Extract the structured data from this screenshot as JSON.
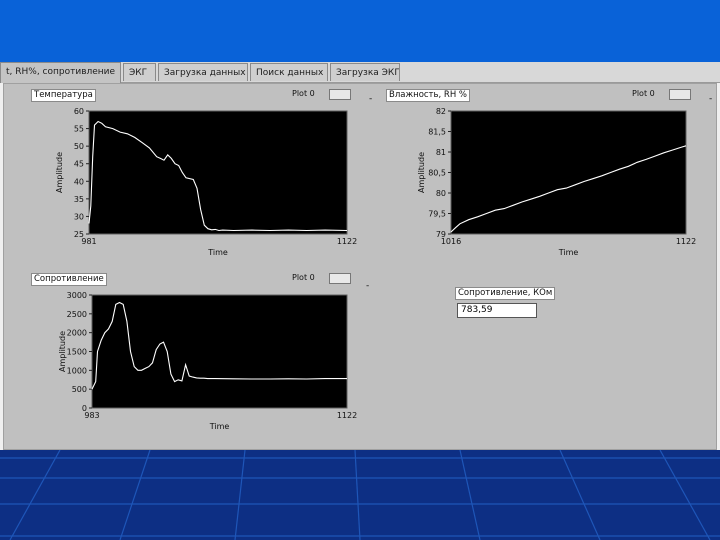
{
  "tabs": [
    {
      "label": "t, RH%, сопротивление"
    },
    {
      "label": "ЭКГ"
    },
    {
      "label": "Загрузка данных"
    },
    {
      "label": "Поиск данных"
    },
    {
      "label": "Загрузка ЭКГ"
    }
  ],
  "dash_marks": [
    "-",
    "-",
    "-"
  ],
  "result": {
    "label": "Сопротивление, КОм",
    "value": "783,59"
  },
  "colors": {
    "plot_bg": "#000000",
    "trace": "#ffffff",
    "panel": "#c0c0c0",
    "slide_blue": "#0962d8"
  },
  "chart_data": [
    {
      "type": "line",
      "title": "Температура",
      "legend": "Plot 0",
      "xlabel": "Time",
      "ylabel": "Amplitude",
      "xlim": [
        981,
        1122
      ],
      "ylim": [
        25,
        60
      ],
      "xticks": [
        "981",
        "1122"
      ],
      "yticks": [
        "60",
        "55",
        "50",
        "45",
        "40",
        "35",
        "30",
        "25"
      ],
      "x": [
        981,
        982,
        983,
        984,
        986,
        988,
        990,
        994,
        998,
        1002,
        1006,
        1010,
        1014,
        1018,
        1020,
        1022,
        1024,
        1026,
        1028,
        1030,
        1032,
        1034,
        1038,
        1040,
        1042,
        1044,
        1046,
        1048,
        1050,
        1052,
        1054,
        1060,
        1070,
        1080,
        1090,
        1100,
        1110,
        1122
      ],
      "y": [
        28,
        33,
        47,
        56,
        57,
        56.5,
        55.5,
        55,
        54,
        53.5,
        52.5,
        51,
        49.5,
        47,
        46.5,
        46,
        47.5,
        46.5,
        45,
        44.5,
        42.5,
        41,
        40.5,
        38,
        32,
        27.5,
        26.5,
        26.2,
        26.3,
        26,
        26.1,
        26,
        26.1,
        26,
        26.1,
        26,
        26.1,
        26
      ]
    },
    {
      "type": "line",
      "title": "Влажность, RH %",
      "legend": "Plot 0",
      "xlabel": "Time",
      "ylabel": "Amplitude",
      "xlim": [
        1016,
        1122
      ],
      "ylim": [
        79,
        82
      ],
      "xticks": [
        "1016",
        "1122"
      ],
      "yticks": [
        "82",
        "81,5",
        "81",
        "80,5",
        "80",
        "79,5",
        "79"
      ],
      "x": [
        1016,
        1018,
        1020,
        1024,
        1028,
        1032,
        1036,
        1040,
        1044,
        1048,
        1052,
        1056,
        1060,
        1064,
        1068,
        1072,
        1076,
        1080,
        1084,
        1088,
        1092,
        1096,
        1100,
        1104,
        1108,
        1112,
        1116,
        1120,
        1122
      ],
      "y": [
        79.05,
        79.15,
        79.25,
        79.35,
        79.42,
        79.5,
        79.58,
        79.62,
        79.7,
        79.78,
        79.85,
        79.92,
        80.0,
        80.08,
        80.12,
        80.2,
        80.28,
        80.35,
        80.42,
        80.5,
        80.58,
        80.65,
        80.75,
        80.82,
        80.9,
        80.98,
        81.05,
        81.12,
        81.15
      ]
    },
    {
      "type": "line",
      "title": "Сопротивление",
      "legend": "Plot 0",
      "xlabel": "Time",
      "ylabel": "Amplitude",
      "xlim": [
        983,
        1122
      ],
      "ylim": [
        0,
        3000
      ],
      "xticks": [
        "983",
        "1122"
      ],
      "yticks": [
        "3000",
        "2500",
        "2000",
        "1500",
        "1000",
        "500",
        "0"
      ],
      "x": [
        983,
        985,
        986,
        988,
        990,
        992,
        994,
        996,
        998,
        1000,
        1002,
        1004,
        1006,
        1008,
        1010,
        1012,
        1014,
        1016,
        1018,
        1020,
        1022,
        1024,
        1026,
        1028,
        1030,
        1032,
        1034,
        1036,
        1038,
        1040,
        1042,
        1044,
        1046,
        1048,
        1050,
        1060,
        1070,
        1080,
        1090,
        1100,
        1110,
        1122
      ],
      "y": [
        500,
        700,
        1500,
        1800,
        2000,
        2100,
        2300,
        2750,
        2800,
        2750,
        2300,
        1500,
        1100,
        1000,
        1000,
        1050,
        1100,
        1200,
        1550,
        1700,
        1750,
        1500,
        900,
        700,
        750,
        720,
        1150,
        850,
        820,
        800,
        790,
        790,
        780,
        780,
        780,
        775,
        770,
        770,
        775,
        770,
        780,
        780
      ]
    }
  ]
}
